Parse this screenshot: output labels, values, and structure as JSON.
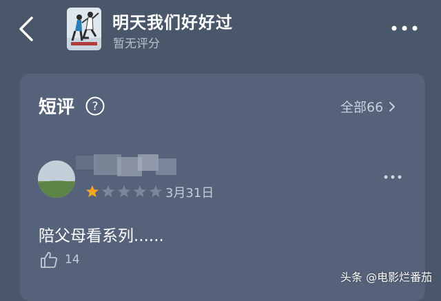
{
  "header": {
    "title": "明天我们好好过",
    "subtitle": "暂无评分",
    "back_icon": "chevron-left-icon",
    "more_icon": "more-horizontal-icon"
  },
  "short_reviews": {
    "section_title": "短评",
    "help_icon": "question-circle-icon",
    "all_label": "全部66",
    "all_icon": "chevron-right-icon",
    "review": {
      "rating": 1,
      "rating_max": 5,
      "date": "3月31日",
      "text": "陪父母看系列......",
      "like_count": "14",
      "like_icon": "thumbs-up-icon"
    }
  },
  "watermark": "头条 @电影烂番茄",
  "colors": {
    "background": "#4a5669",
    "card": "#56627a",
    "star_active": "#f5a623",
    "star_inactive": "#7b8699"
  }
}
